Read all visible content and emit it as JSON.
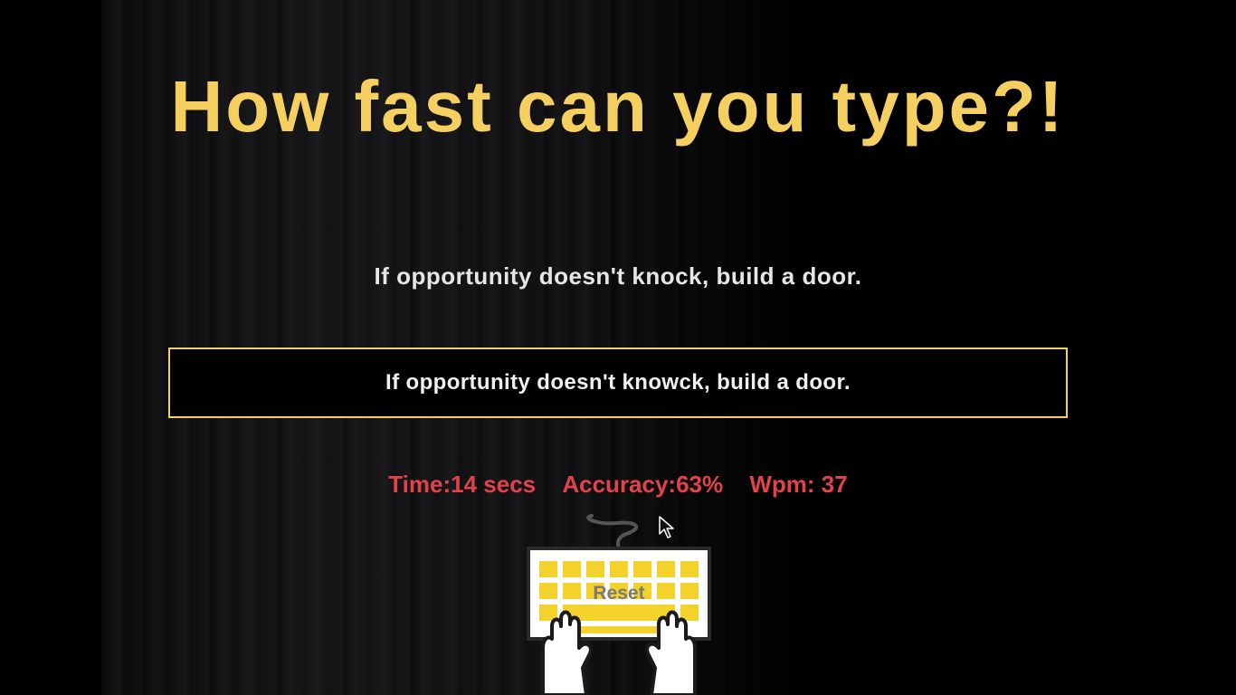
{
  "header": {
    "title": "How fast can you type?!"
  },
  "quote": {
    "text": "If opportunity doesn't knock, build a door."
  },
  "typing": {
    "value": "If opportunity doesn't knowck, build a door."
  },
  "stats": {
    "time": "Time:14 secs",
    "accuracy": "Accuracy:63%",
    "wpm": "Wpm: 37"
  },
  "reset": {
    "label": "Reset"
  },
  "icons": {
    "keyboard": "keyboard-with-hands-icon",
    "cursor": "mouse-pointer-icon"
  },
  "colors": {
    "accent": "#f5d061",
    "stats": "#e2424a",
    "background": "#000000"
  }
}
